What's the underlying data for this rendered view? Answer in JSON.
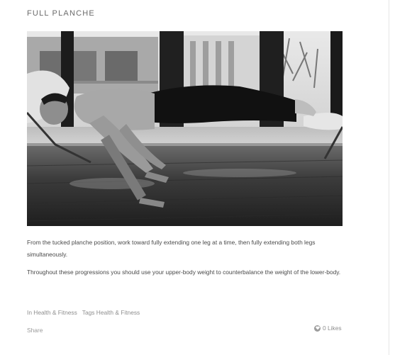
{
  "post": {
    "title": "FULL PLANCHE",
    "paragraphs": [
      "From the tucked planche position, work toward fully extending one leg at a time, then fully extending both legs simultaneously.",
      "Throughout these progressions you should use your upper-body weight to counterbalance the weight of the lower-body."
    ],
    "category_label": "In Health & Fitness",
    "tags_label": "Tags Health & Fitness",
    "share_label": "Share",
    "likes_label": "0 Likes"
  },
  "icons": {
    "likes": "heart-icon"
  }
}
